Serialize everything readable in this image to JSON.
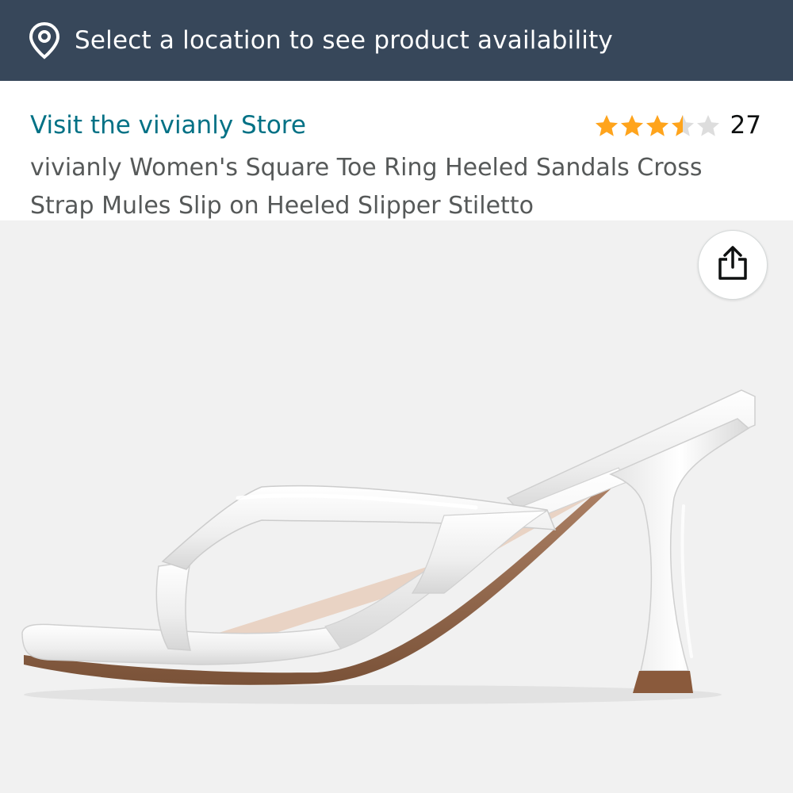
{
  "location_bar": {
    "icon": "location-pin-icon",
    "text": "Select a location to see product availability"
  },
  "product": {
    "store_link": "Visit the vivianly Store",
    "rating": {
      "stars": 3.5,
      "out_of": 5,
      "count": "27",
      "star_color": "#ffa41c",
      "empty_star_color": "#dddddd"
    },
    "title": "vivianly Women's Square Toe Ring Heeled Sandals Cross Strap Mules Slip on Heeled Slipper Stiletto"
  },
  "gallery": {
    "share_icon": "share-icon",
    "image_alt": "white-patent-heeled-thong-mule-sandal"
  },
  "colors": {
    "location_bar_bg": "#37475a",
    "link": "#007185",
    "title_text": "#565959",
    "gallery_bg": "#f1f1f1"
  }
}
